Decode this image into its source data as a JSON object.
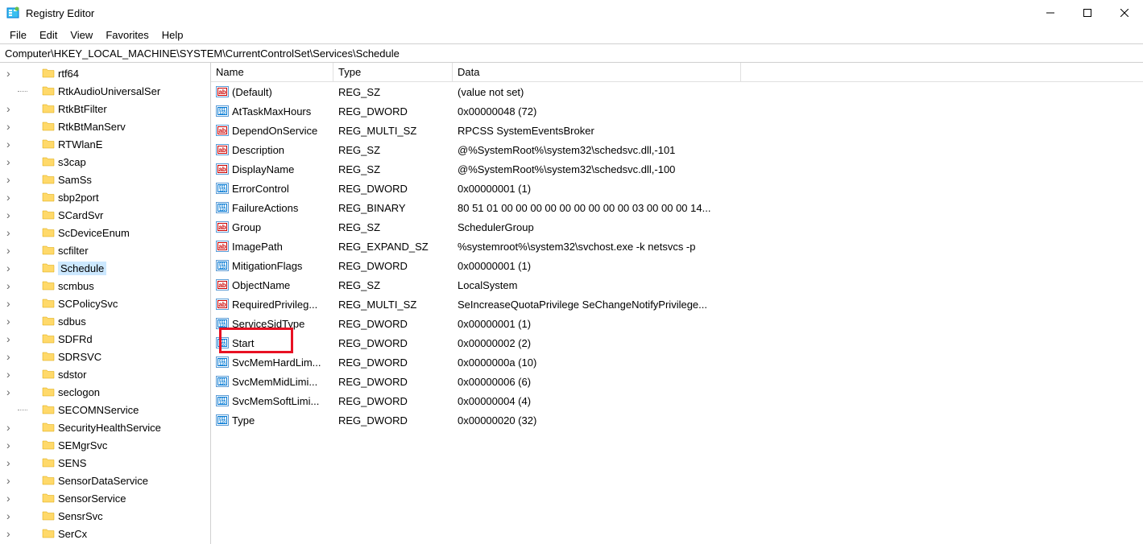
{
  "window": {
    "title": "Registry Editor"
  },
  "menu": [
    "File",
    "Edit",
    "View",
    "Favorites",
    "Help"
  ],
  "address": "Computer\\HKEY_LOCAL_MACHINE\\SYSTEM\\CurrentControlSet\\Services\\Schedule",
  "tree": [
    {
      "label": "rtf64",
      "hasChildren": true
    },
    {
      "label": "RtkAudioUniversalSer",
      "hasChildren": false
    },
    {
      "label": "RtkBtFilter",
      "hasChildren": true
    },
    {
      "label": "RtkBtManServ",
      "hasChildren": true
    },
    {
      "label": "RTWlanE",
      "hasChildren": true
    },
    {
      "label": "s3cap",
      "hasChildren": true
    },
    {
      "label": "SamSs",
      "hasChildren": true
    },
    {
      "label": "sbp2port",
      "hasChildren": true
    },
    {
      "label": "SCardSvr",
      "hasChildren": true
    },
    {
      "label": "ScDeviceEnum",
      "hasChildren": true
    },
    {
      "label": "scfilter",
      "hasChildren": true
    },
    {
      "label": "Schedule",
      "hasChildren": true,
      "selected": true
    },
    {
      "label": "scmbus",
      "hasChildren": true
    },
    {
      "label": "SCPolicySvc",
      "hasChildren": true
    },
    {
      "label": "sdbus",
      "hasChildren": true
    },
    {
      "label": "SDFRd",
      "hasChildren": true
    },
    {
      "label": "SDRSVC",
      "hasChildren": true
    },
    {
      "label": "sdstor",
      "hasChildren": true
    },
    {
      "label": "seclogon",
      "hasChildren": true
    },
    {
      "label": "SECOMNService",
      "hasChildren": false
    },
    {
      "label": "SecurityHealthService",
      "hasChildren": true
    },
    {
      "label": "SEMgrSvc",
      "hasChildren": true
    },
    {
      "label": "SENS",
      "hasChildren": true
    },
    {
      "label": "SensorDataService",
      "hasChildren": true
    },
    {
      "label": "SensorService",
      "hasChildren": true
    },
    {
      "label": "SensrSvc",
      "hasChildren": true
    },
    {
      "label": "SerCx",
      "hasChildren": true
    }
  ],
  "columns": {
    "name": "Name",
    "type": "Type",
    "data": "Data"
  },
  "values": [
    {
      "name": "(Default)",
      "type": "REG_SZ",
      "data": "(value not set)",
      "kind": "sz"
    },
    {
      "name": "AtTaskMaxHours",
      "type": "REG_DWORD",
      "data": "0x00000048 (72)",
      "kind": "bin"
    },
    {
      "name": "DependOnService",
      "type": "REG_MULTI_SZ",
      "data": "RPCSS SystemEventsBroker",
      "kind": "sz"
    },
    {
      "name": "Description",
      "type": "REG_SZ",
      "data": "@%SystemRoot%\\system32\\schedsvc.dll,-101",
      "kind": "sz"
    },
    {
      "name": "DisplayName",
      "type": "REG_SZ",
      "data": "@%SystemRoot%\\system32\\schedsvc.dll,-100",
      "kind": "sz"
    },
    {
      "name": "ErrorControl",
      "type": "REG_DWORD",
      "data": "0x00000001 (1)",
      "kind": "bin"
    },
    {
      "name": "FailureActions",
      "type": "REG_BINARY",
      "data": "80 51 01 00 00 00 00 00 00 00 00 00 03 00 00 00 14...",
      "kind": "bin"
    },
    {
      "name": "Group",
      "type": "REG_SZ",
      "data": "SchedulerGroup",
      "kind": "sz"
    },
    {
      "name": "ImagePath",
      "type": "REG_EXPAND_SZ",
      "data": "%systemroot%\\system32\\svchost.exe -k netsvcs -p",
      "kind": "sz"
    },
    {
      "name": "MitigationFlags",
      "type": "REG_DWORD",
      "data": "0x00000001 (1)",
      "kind": "bin"
    },
    {
      "name": "ObjectName",
      "type": "REG_SZ",
      "data": "LocalSystem",
      "kind": "sz"
    },
    {
      "name": "RequiredPrivileg...",
      "type": "REG_MULTI_SZ",
      "data": "SeIncreaseQuotaPrivilege SeChangeNotifyPrivilege...",
      "kind": "sz"
    },
    {
      "name": "ServiceSidType",
      "type": "REG_DWORD",
      "data": "0x00000001 (1)",
      "kind": "bin"
    },
    {
      "name": "Start",
      "type": "REG_DWORD",
      "data": "0x00000002 (2)",
      "kind": "bin",
      "highlight": true
    },
    {
      "name": "SvcMemHardLim...",
      "type": "REG_DWORD",
      "data": "0x0000000a (10)",
      "kind": "bin"
    },
    {
      "name": "SvcMemMidLimi...",
      "type": "REG_DWORD",
      "data": "0x00000006 (6)",
      "kind": "bin"
    },
    {
      "name": "SvcMemSoftLimi...",
      "type": "REG_DWORD",
      "data": "0x00000004 (4)",
      "kind": "bin"
    },
    {
      "name": "Type",
      "type": "REG_DWORD",
      "data": "0x00000020 (32)",
      "kind": "bin"
    }
  ]
}
